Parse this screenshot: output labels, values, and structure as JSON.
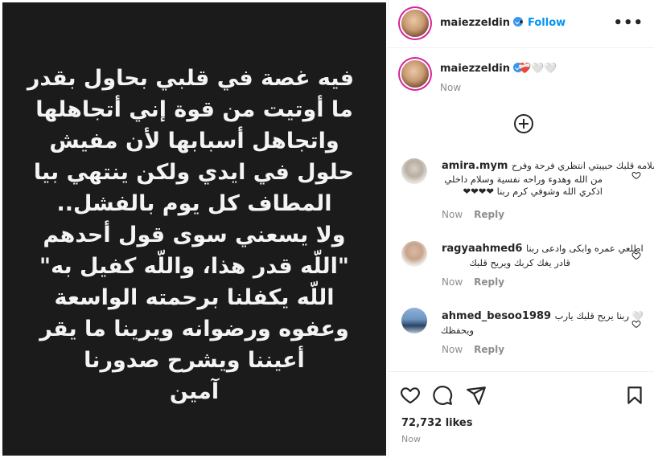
{
  "post": {
    "text_lines": [
      "فيه غصة في قلبي بحاول بقدر",
      "ما أوتيت من قوة إني أتجاهلها",
      "واتجاهل أسبابها لأن مفيش",
      "حلول في ايدي ولكن ينتهي بيا",
      "المطاف كل يوم بالفشل..",
      "ولا يسعني سوى قول أحدهم",
      "\"اللّه قدر هذا، واللّه كفيل به\"",
      "اللّه يكفلنا برحمته الواسعة",
      "وعفوه ورضوانه ويرينا ما يقر",
      "أعيننا ويشرح صدورنا",
      "آمين"
    ]
  },
  "header": {
    "username": "maiezzeldin",
    "separator": "•",
    "follow_label": "Follow",
    "more_label": "•••"
  },
  "caption": {
    "username": "maiezzeldin",
    "emojis": "❤️‍🩹🤍🤍",
    "time": "Now"
  },
  "comments": [
    {
      "username": "amira.mym",
      "text_first": "سلامه قلبك حبيبتي انتظري فرحة وفرح",
      "text_rest": "من الله وهدوء وراحه نفسية وسلام داخلي اذكري الله وشوفي كرم ربنا ❤❤❤❤",
      "time": "Now",
      "reply": "Reply"
    },
    {
      "username": "ragyaahmed6",
      "text_first": "اطلعي عمره وابكى وادعى ربنا",
      "text_rest": "قادر يغك كربك ويريح قلبك",
      "time": "Now",
      "reply": "Reply"
    },
    {
      "username": "ahmed_besoo1989",
      "text_first": "ربنا يريح قلبك يارب 🤍",
      "text_rest": "ويحفظك",
      "time": "Now",
      "reply": "Reply"
    }
  ],
  "footer": {
    "likes": "72,732 likes",
    "time": "Now"
  },
  "icons": {
    "like": "heart-icon",
    "comment": "comment-icon",
    "share": "share-icon",
    "save": "bookmark-icon",
    "add_comment": "plus-circle-icon",
    "verified": "verified-badge-icon"
  },
  "colors": {
    "accent": "#0095f6",
    "verified": "#3897f0",
    "media_bg": "#1b1b1b",
    "text": "#262626",
    "muted": "#8e8e8e"
  }
}
